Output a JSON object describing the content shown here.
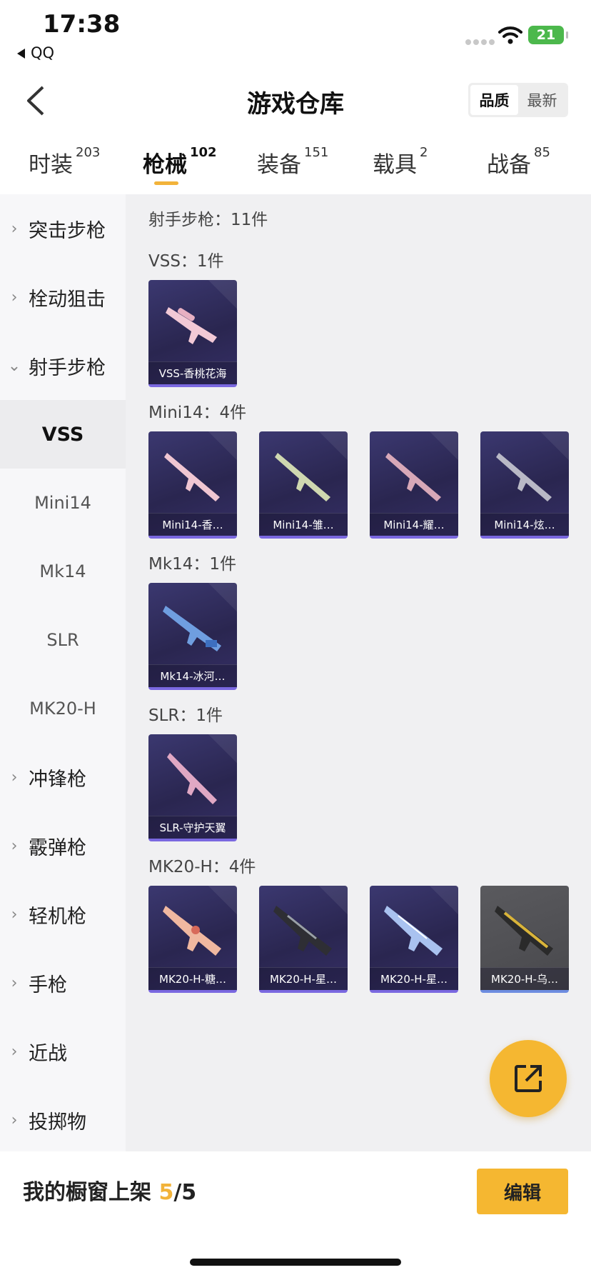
{
  "status_bar": {
    "time": "17:38",
    "back_app": "QQ",
    "battery": "21"
  },
  "header": {
    "title": "游戏仓库",
    "sort_options": [
      "品质",
      "最新"
    ]
  },
  "tabs": [
    {
      "label": "时装",
      "count": "203"
    },
    {
      "label": "枪械",
      "count": "102"
    },
    {
      "label": "装备",
      "count": "151"
    },
    {
      "label": "载具",
      "count": "2"
    },
    {
      "label": "战备",
      "count": "85"
    }
  ],
  "sidebar": {
    "items": [
      "突击步枪",
      "栓动狙击",
      "射手步枪",
      "VSS",
      "Mini14",
      "Mk14",
      "SLR",
      "MK20-H",
      "冲锋枪",
      "霰弹枪",
      "轻机枪",
      "手枪",
      "近战",
      "投掷物"
    ]
  },
  "content": {
    "section_title": "射手步枪：11件",
    "groups": [
      {
        "title": "VSS：1件",
        "items": [
          "VSS-香桃花海"
        ]
      },
      {
        "title": "Mini14：4件",
        "items": [
          "Mini14-香…",
          "Mini14-雏…",
          "Mini14-耀…",
          "Mini14-炫…"
        ]
      },
      {
        "title": "Mk14：1件",
        "items": [
          "Mk14-冰河…"
        ]
      },
      {
        "title": "SLR：1件",
        "items": [
          "SLR-守护天翼"
        ]
      },
      {
        "title": "MK20-H：4件",
        "items": [
          "MK20-H-糖…",
          "MK20-H-星…",
          "MK20-H-星…",
          "MK20-H-乌…"
        ]
      }
    ]
  },
  "bottom": {
    "shelf_label": "我的橱窗上架",
    "shelf_current": "5",
    "shelf_total": "/5",
    "edit_label": "编辑"
  },
  "colors": {
    "accent": "#f5b731",
    "card_bg": "#2a2650",
    "card_border": "#7a68e0"
  }
}
